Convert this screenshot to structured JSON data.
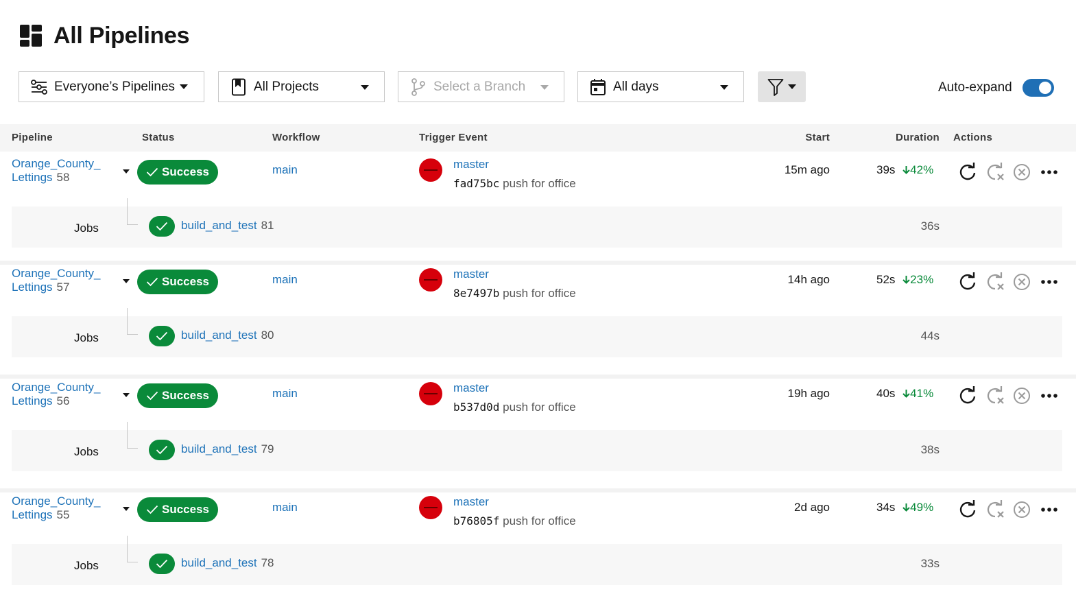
{
  "page": {
    "title": "All Pipelines"
  },
  "filters": {
    "pipelines": "Everyone’s Pipelines",
    "projects": "All Projects",
    "branch_placeholder": "Select a Branch",
    "days": "All days",
    "auto_expand_label": "Auto-expand",
    "auto_expand_on": true
  },
  "table": {
    "headers": {
      "pipeline": "Pipeline",
      "status": "Status",
      "workflow": "Workflow",
      "trigger": "Trigger Event",
      "start": "Start",
      "duration": "Duration",
      "actions": "Actions"
    },
    "jobs_label": "Jobs",
    "rows": [
      {
        "name_line1": "Orange_County_",
        "name_line2": "Lettings",
        "number": "58",
        "status": "Success",
        "workflow": "main",
        "branch": "master",
        "sha": "fad75bc",
        "message": "push for office",
        "start": "15m ago",
        "duration": "39s",
        "delta": "42%",
        "job": "build_and_test",
        "job_number": "81",
        "job_duration": "36s"
      },
      {
        "name_line1": "Orange_County_",
        "name_line2": "Lettings",
        "number": "57",
        "status": "Success",
        "workflow": "main",
        "branch": "master",
        "sha": "8e7497b",
        "message": "push for office",
        "start": "14h ago",
        "duration": "52s",
        "delta": "23%",
        "job": "build_and_test",
        "job_number": "80",
        "job_duration": "44s"
      },
      {
        "name_line1": "Orange_County_",
        "name_line2": "Lettings",
        "number": "56",
        "status": "Success",
        "workflow": "main",
        "branch": "master",
        "sha": "b537d0d",
        "message": "push for office",
        "start": "19h ago",
        "duration": "40s",
        "delta": "41%",
        "job": "build_and_test",
        "job_number": "79",
        "job_duration": "38s"
      },
      {
        "name_line1": "Orange_County_",
        "name_line2": "Lettings",
        "number": "55",
        "status": "Success",
        "workflow": "main",
        "branch": "master",
        "sha": "b76805f",
        "message": "push for office",
        "start": "2d ago",
        "duration": "34s",
        "delta": "49%",
        "job": "build_and_test",
        "job_number": "78",
        "job_duration": "33s"
      }
    ]
  },
  "colors": {
    "success": "#0a8a3a",
    "link": "#1d72b8",
    "toggle": "#1f6fb5",
    "avatar": "#d6000b"
  }
}
